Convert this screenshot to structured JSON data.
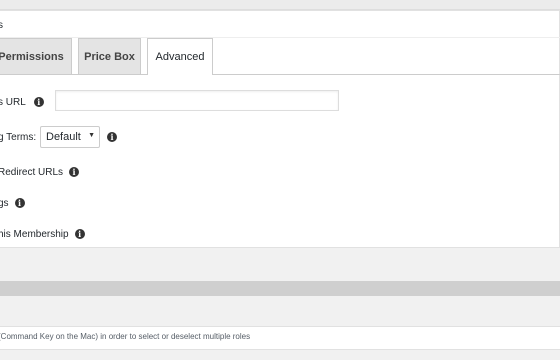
{
  "metabox": {
    "title": "s"
  },
  "tabs": [
    {
      "label": "Permissions",
      "active": false
    },
    {
      "label": "Price Box",
      "active": false
    },
    {
      "label": "Advanced",
      "active": true
    }
  ],
  "advanced": {
    "url_label": "s URL",
    "url_value": "",
    "terms_label": "g Terms:",
    "terms_selected": "Default",
    "redirect_label": "Redirect URLs",
    "tags_label": "gs",
    "membership_label": "his Membership",
    "info_icon_glyph": "i"
  },
  "help": {
    "text": "(Command Key on the Mac) in order to select or deselect multiple roles"
  },
  "icons": {
    "info": "info-circle-icon",
    "dropdown": "dropdown-caret-icon"
  },
  "colors": {
    "background": "#f1f1f1",
    "panel": "#ffffff",
    "inactive_tab": "#e4e4e4",
    "border": "#cccccc",
    "gray_bar": "#cfcfcf"
  }
}
